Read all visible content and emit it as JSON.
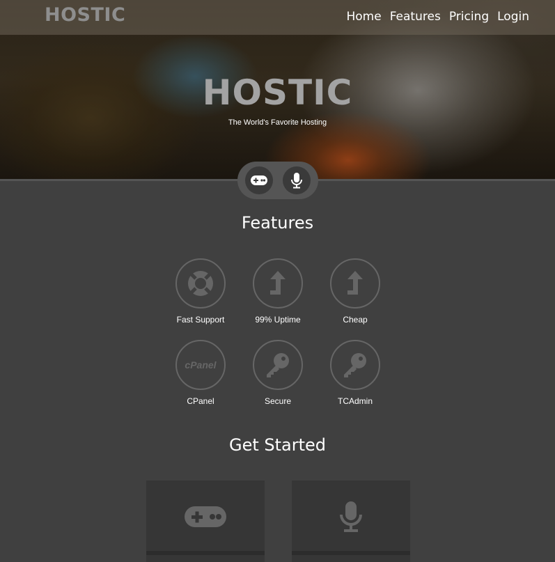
{
  "brand": "HOSTIC",
  "nav": [
    "Home",
    "Features",
    "Pricing",
    "Login"
  ],
  "hero": {
    "title": "HOSTIC",
    "subtitle": "The World's Favorite Hosting"
  },
  "pill_buttons": [
    {
      "icon": "gamepad-icon"
    },
    {
      "icon": "microphone-icon"
    }
  ],
  "features_section": {
    "title": "Features",
    "items": [
      {
        "label": "Fast Support",
        "icon": "lifebuoy-icon"
      },
      {
        "label": "99% Uptime",
        "icon": "arrow-up-icon"
      },
      {
        "label": "Cheap",
        "icon": "arrow-up-icon"
      },
      {
        "label": "CPanel",
        "icon": "cpanel-logo-icon",
        "logo_text": "cPanel"
      },
      {
        "label": "Secure",
        "icon": "key-icon"
      },
      {
        "label": "TCAdmin",
        "icon": "key-icon"
      }
    ]
  },
  "get_started": {
    "title": "Get Started",
    "cards": [
      {
        "icon": "gamepad-icon"
      },
      {
        "icon": "microphone-icon"
      }
    ]
  }
}
